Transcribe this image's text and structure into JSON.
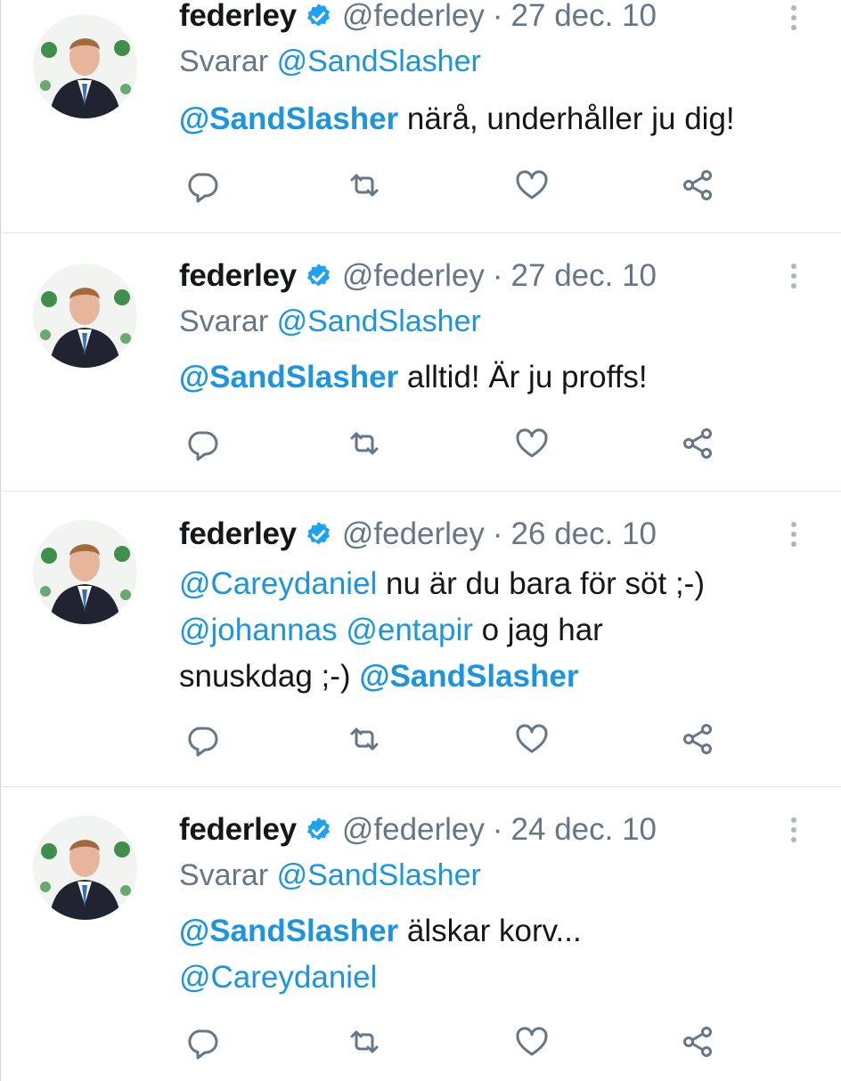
{
  "colors": {
    "link": "#1b95e0",
    "muted": "#657786",
    "text": "#14171a",
    "verified": "#1da1f2"
  },
  "icons": {
    "verified": "verified-badge-icon",
    "more": "more-vertical-icon",
    "reply": "reply-icon",
    "retweet": "retweet-icon",
    "like": "heart-icon",
    "share": "share-icon"
  },
  "tweets": [
    {
      "name": "federley",
      "handle": "@federley",
      "separator": "·",
      "date": "27 dec. 10",
      "reply_prefix": "Svarar",
      "reply_to": "@SandSlasher",
      "segments": [
        {
          "text": "@SandSlasher",
          "type": "mention-bold"
        },
        {
          "text": " närå, underhåller ju dig!",
          "type": "text"
        }
      ]
    },
    {
      "name": "federley",
      "handle": "@federley",
      "separator": "·",
      "date": "27 dec. 10",
      "reply_prefix": "Svarar",
      "reply_to": "@SandSlasher",
      "segments": [
        {
          "text": "@SandSlasher",
          "type": "mention-bold"
        },
        {
          "text": " alltid! Är ju proffs!",
          "type": "text"
        }
      ]
    },
    {
      "name": "federley",
      "handle": "@federley",
      "separator": "·",
      "date": "26 dec. 10",
      "segments": [
        {
          "text": "@Careydaniel",
          "type": "mention"
        },
        {
          "text": " nu är du bara för söt ;-)",
          "type": "text"
        },
        {
          "type": "br"
        },
        {
          "text": "@johannas",
          "type": "mention"
        },
        {
          "text": " ",
          "type": "text"
        },
        {
          "text": "@entapir",
          "type": "mention"
        },
        {
          "text": " o jag har",
          "type": "text"
        },
        {
          "type": "br"
        },
        {
          "text": "snuskdag ;-) ",
          "type": "text"
        },
        {
          "text": "@SandSlasher",
          "type": "mention-bold"
        }
      ]
    },
    {
      "name": "federley",
      "handle": "@federley",
      "separator": "·",
      "date": "24 dec. 10",
      "reply_prefix": "Svarar",
      "reply_to": "@SandSlasher",
      "segments": [
        {
          "text": "@SandSlasher",
          "type": "mention-bold"
        },
        {
          "text": " älskar korv...",
          "type": "text"
        },
        {
          "type": "br"
        },
        {
          "text": "@Careydaniel",
          "type": "mention"
        }
      ]
    }
  ]
}
